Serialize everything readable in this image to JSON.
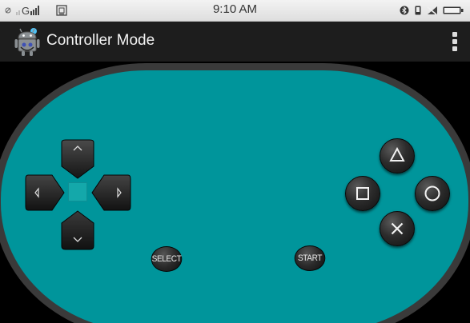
{
  "status_bar": {
    "time": "9:10 AM",
    "carrier": "G",
    "left_icons": [
      "no-sim-icon",
      "signal-icon",
      "sim-card-icon"
    ],
    "right_icons": [
      "bluetooth-icon",
      "vibrate-icon",
      "no-signal-icon",
      "battery-icon"
    ]
  },
  "action_bar": {
    "title": "Controller Mode",
    "app_icon": "android-robot-icon",
    "menu_icon": "overflow-menu-icon"
  },
  "controller": {
    "body_color": "#00959b",
    "dpad": [
      "up",
      "down",
      "left",
      "right"
    ],
    "select_label": "SELECT",
    "start_label": "START",
    "face_buttons": [
      "triangle",
      "square",
      "circle",
      "cross"
    ]
  }
}
